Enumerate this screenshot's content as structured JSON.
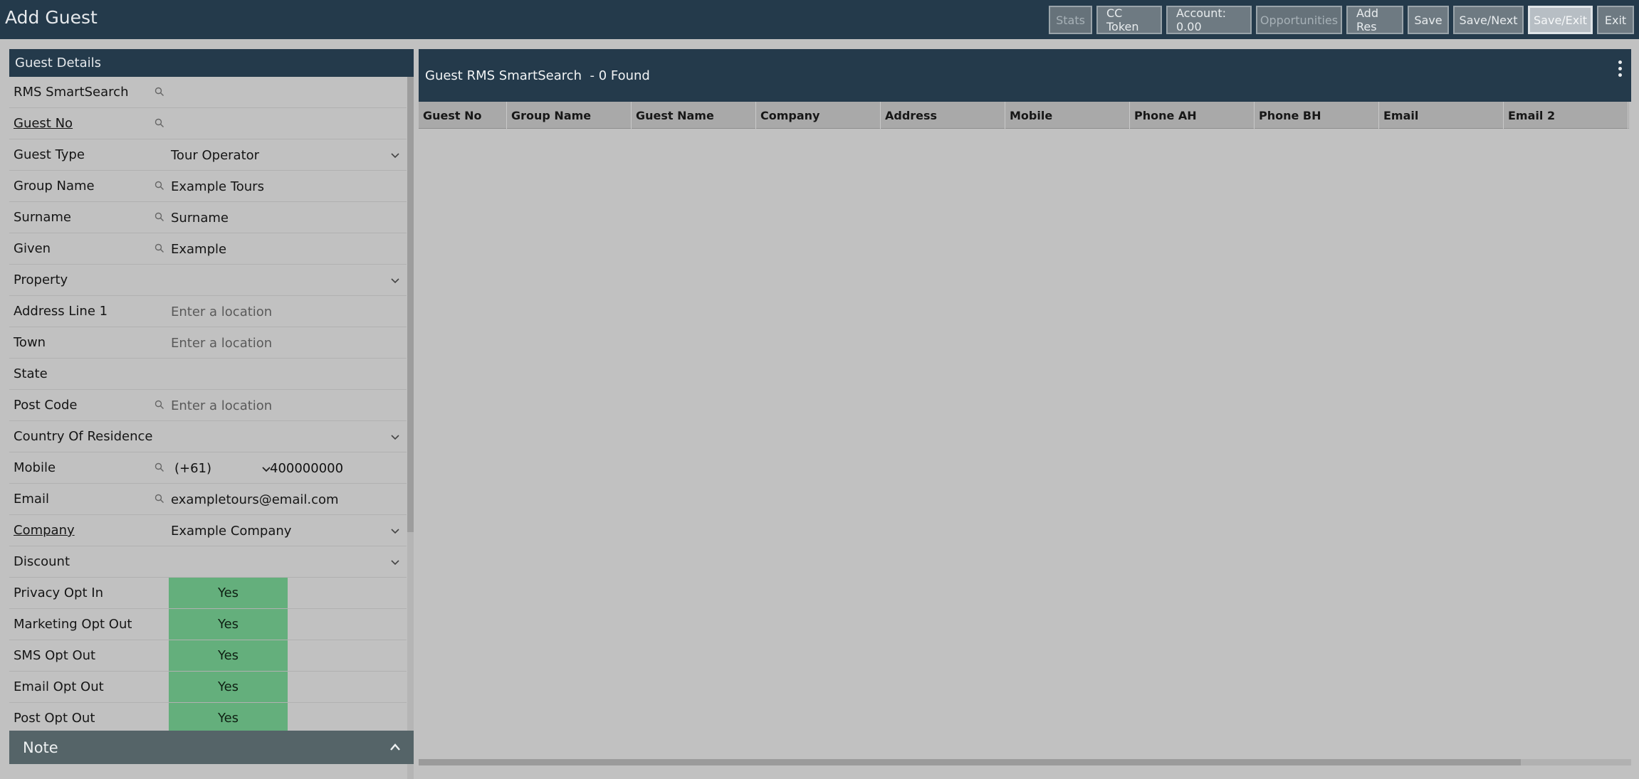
{
  "window": {
    "title": "Add Guest"
  },
  "toolbar": {
    "stats": "Stats",
    "cc_token": "CC Token",
    "account": "Account: 0.00",
    "opportunities": "Opportunities",
    "add_res": "Add Res",
    "save": "Save",
    "save_next": "Save/Next",
    "save_exit": "Save/Exit",
    "exit": "Exit"
  },
  "guest_details": {
    "header": "Guest Details",
    "rms_smartsearch": {
      "label": "RMS SmartSearch",
      "value": ""
    },
    "guest_no": {
      "label": "Guest No",
      "value": ""
    },
    "guest_type": {
      "label": "Guest Type",
      "value": "Tour Operator"
    },
    "group_name": {
      "label": "Group Name",
      "value": "Example Tours"
    },
    "surname": {
      "label": "Surname",
      "value": "Surname"
    },
    "given": {
      "label": "Given",
      "value": "Example"
    },
    "property": {
      "label": "Property",
      "value": ""
    },
    "address_line_1": {
      "label": "Address Line 1",
      "placeholder": "Enter a location"
    },
    "town": {
      "label": "Town",
      "placeholder": "Enter a location"
    },
    "state": {
      "label": "State",
      "value": ""
    },
    "post_code": {
      "label": "Post Code",
      "placeholder": "Enter a location"
    },
    "country_of_residence": {
      "label": "Country Of Residence",
      "value": ""
    },
    "mobile": {
      "label": "Mobile",
      "country_code": "(+61)",
      "number": "400000000"
    },
    "email": {
      "label": "Email",
      "value": "exampletours@email.com"
    },
    "company": {
      "label": "Company",
      "value": "Example Company"
    },
    "discount": {
      "label": "Discount",
      "value": ""
    },
    "privacy_opt_in": {
      "label": "Privacy Opt In",
      "value": "Yes"
    },
    "marketing_opt_out": {
      "label": "Marketing Opt Out",
      "value": "Yes"
    },
    "sms_opt_out": {
      "label": "SMS Opt Out",
      "value": "Yes"
    },
    "email_opt_out": {
      "label": "Email Opt Out",
      "value": "Yes"
    },
    "post_opt_out": {
      "label": "Post Opt Out",
      "value": "Yes"
    }
  },
  "note": {
    "label": "Note"
  },
  "smartsearch": {
    "header": "Guest RMS SmartSearch  - 0 Found",
    "columns": [
      "Guest No",
      "Group Name",
      "Guest Name",
      "Company",
      "Address",
      "Mobile",
      "Phone AH",
      "Phone BH",
      "Email",
      "Email 2"
    ]
  },
  "colors": {
    "header_bg": "#243a4b",
    "yes_green": "#64af7c",
    "page_bg": "#c1c1c1"
  }
}
